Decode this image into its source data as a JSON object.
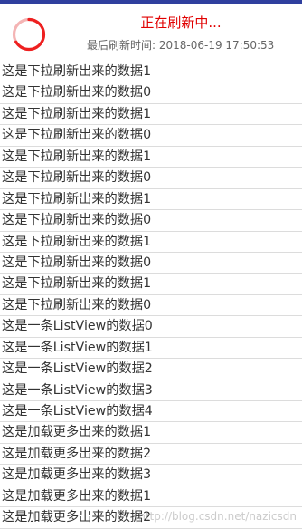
{
  "header": {
    "title": "正在刷新中...",
    "last_refresh": "最后刷新时间: 2018-06-19 17:50:53",
    "spinner_icon": "progress-spinner-icon",
    "accent_color": "#e10000"
  },
  "list": {
    "items": [
      "这是下拉刷新出来的数据1",
      "这是下拉刷新出来的数据0",
      "这是下拉刷新出来的数据1",
      "这是下拉刷新出来的数据0",
      "这是下拉刷新出来的数据1",
      "这是下拉刷新出来的数据0",
      "这是下拉刷新出来的数据1",
      "这是下拉刷新出来的数据0",
      "这是下拉刷新出来的数据1",
      "这是下拉刷新出来的数据0",
      "这是下拉刷新出来的数据1",
      "这是下拉刷新出来的数据0",
      "这是一条ListView的数据0",
      "这是一条ListView的数据1",
      "这是一条ListView的数据2",
      "这是一条ListView的数据3",
      "这是一条ListView的数据4",
      "这是加载更多出来的数据1",
      "这是加载更多出来的数据2",
      "这是加载更多出来的数据3",
      "这是加载更多出来的数据1",
      "这是加载更多出来的数据2"
    ]
  },
  "watermark": "http://blog.csdn.net/nazicsdn"
}
